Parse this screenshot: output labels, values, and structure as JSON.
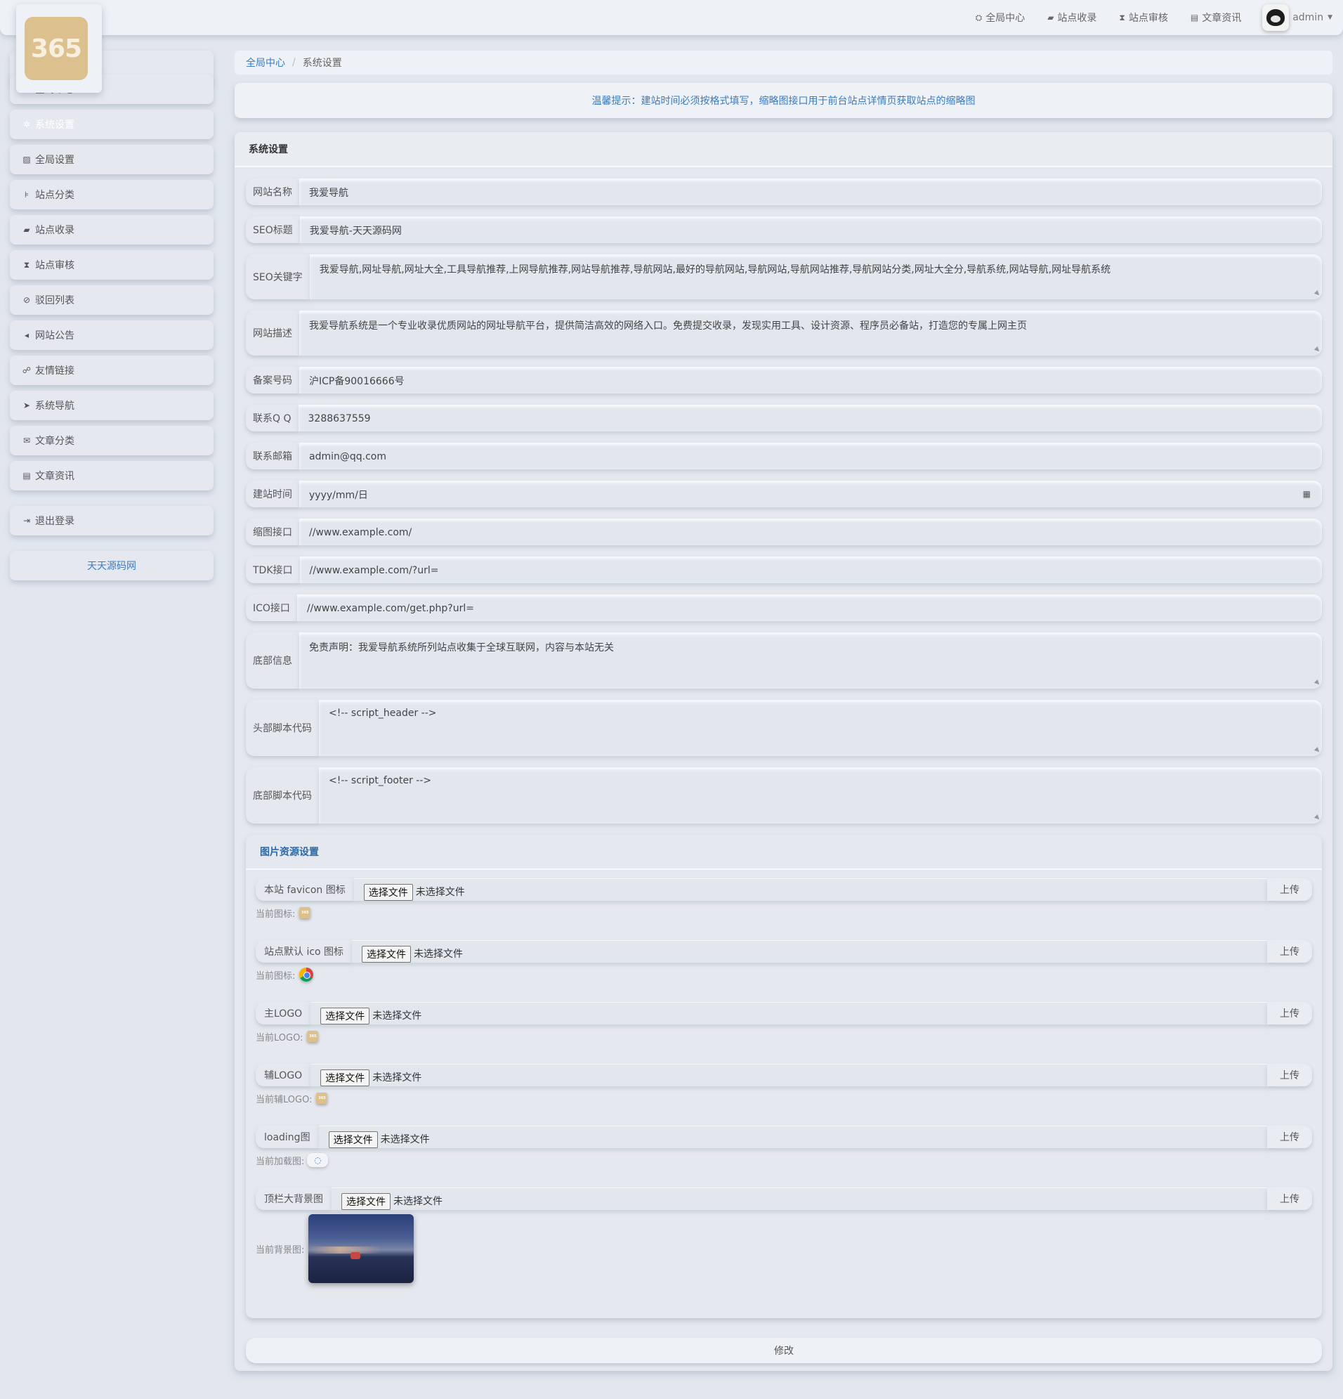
{
  "topbar": {
    "nav": [
      {
        "icon": "dashboard-icon",
        "glyph": "⛭",
        "label": "全局中心"
      },
      {
        "icon": "book-icon",
        "glyph": "▰",
        "label": "站点收录"
      },
      {
        "icon": "hourglass-icon",
        "glyph": "⧗",
        "label": "站点审核"
      },
      {
        "icon": "newspaper-icon",
        "glyph": "▤",
        "label": "文章资讯"
      }
    ],
    "user": "admin"
  },
  "logo": {
    "text": "365"
  },
  "sidebar": {
    "items": [
      {
        "glyph": "⛭",
        "label": "全局中心"
      },
      {
        "glyph": "✲",
        "label": "系统设置"
      },
      {
        "glyph": "▨",
        "label": "全局设置"
      },
      {
        "glyph": "⊧",
        "label": "站点分类"
      },
      {
        "glyph": "▰",
        "label": "站点收录"
      },
      {
        "glyph": "⧗",
        "label": "站点审核"
      },
      {
        "glyph": "⊘",
        "label": "驳回列表"
      },
      {
        "glyph": "◂",
        "label": "网站公告"
      },
      {
        "glyph": "☍",
        "label": "友情链接"
      },
      {
        "glyph": "➤",
        "label": "系统导航"
      },
      {
        "glyph": "✉",
        "label": "文章分类"
      },
      {
        "glyph": "▤",
        "label": "文章资讯"
      }
    ],
    "logout": {
      "glyph": "⇥",
      "label": "退出登录"
    },
    "brand": "天天源码网"
  },
  "breadcrumb": {
    "home": "全局中心",
    "current": "系统设置"
  },
  "tip": "温馨提示：建站时间必须按格式填写，缩略图接口用于前台站点详情页获取站点的缩略图",
  "panel": {
    "title": "系统设置"
  },
  "form": {
    "site_name": {
      "label": "网站名称",
      "value": "我爱导航"
    },
    "seo_title": {
      "label": "SEO标题",
      "value": "我爱导航-天天源码网"
    },
    "seo_keywords": {
      "label": "SEO关键字",
      "value": "我爱导航,网址导航,网址大全,工具导航推荐,上网导航推荐,网站导航推荐,导航网站,最好的导航网站,导航网站,导航网站推荐,导航网站分类,网址大全分,导航系统,网站导航,网址导航系统"
    },
    "site_desc": {
      "label": "网站描述",
      "value": "我爱导航系统是一个专业收录优质网站的网址导航平台，提供简洁高效的网络入口。免费提交收录，发现实用工具、设计资源、程序员必备站，打造您的专属上网主页"
    },
    "icp": {
      "label": "备案号码",
      "value": "沪ICP备90016666号"
    },
    "qq": {
      "label": "联系Q Q",
      "value": "3288637559"
    },
    "email": {
      "label": "联系邮箱",
      "value": "admin@qq.com"
    },
    "build_time": {
      "label": "建站时间",
      "value": "yyyy/mm/日"
    },
    "thumb_api": {
      "label": "缩图接口",
      "value": "//www.example.com/"
    },
    "tdk_api": {
      "label": "TDK接口",
      "value": "//www.example.com/?url="
    },
    "ico_api": {
      "label": "ICO接口",
      "value": "//www.example.com/get.php?url="
    },
    "footer_info": {
      "label": "底部信息",
      "value": "免责声明：我爱导航系统所列站点收集于全球互联网，内容与本站无关"
    },
    "header_script": {
      "label": "头部脚本代码",
      "value": "<!-- script_header -->"
    },
    "footer_script": {
      "label": "底部脚本代码",
      "value": "<!-- script_footer -->"
    }
  },
  "images": {
    "title": "图片资源设置",
    "choose_label": "选择文件",
    "no_file": "未选择文件",
    "upload_label": "上传",
    "items": [
      {
        "label": "本站 favicon 图标",
        "current": "当前图标:"
      },
      {
        "label": "站点默认 ico 图标",
        "current": "当前图标:"
      },
      {
        "label": "主LOGO",
        "current": "当前LOGO:"
      },
      {
        "label": "辅LOGO",
        "current": "当前辅LOGO:"
      },
      {
        "label": "loading图",
        "current": "当前加载图:"
      },
      {
        "label": "顶栏大背景图",
        "current": "当前背景图:"
      }
    ]
  },
  "submit": "修改"
}
